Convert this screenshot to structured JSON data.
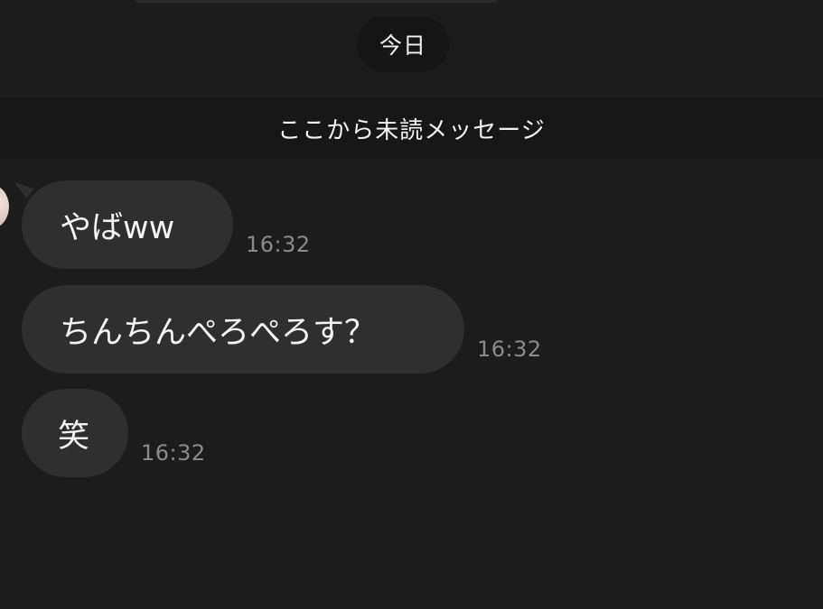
{
  "date_separator": "今日",
  "unread_divider": "ここから未読メッセージ",
  "messages": [
    {
      "text": "やばww",
      "time": "16:32"
    },
    {
      "text": "ちんちんぺろぺろす？",
      "time": "16:32"
    },
    {
      "text": "笑",
      "time": "16:32"
    }
  ],
  "colors": {
    "background": "#1c1c1c",
    "bubble": "#2f2f2f",
    "unread_bar": "#171717",
    "date_pill": "#151515",
    "time_text": "#8b8b8b"
  }
}
